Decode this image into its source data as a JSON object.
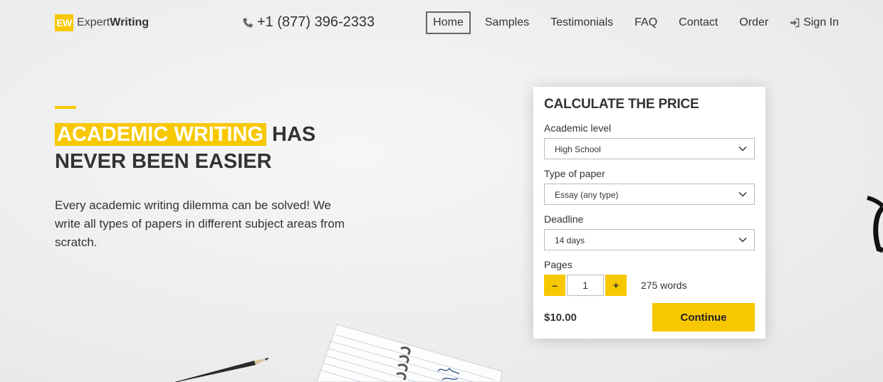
{
  "header": {
    "logo_badge": "EW",
    "logo_text_light": "Expert",
    "logo_text_bold": "Writing",
    "phone": "+1 (877) 396-2333",
    "nav": {
      "home": "Home",
      "samples": "Samples",
      "testimonials": "Testimonials",
      "faq": "FAQ",
      "contact": "Contact",
      "order": "Order",
      "sign_in": "Sign In"
    }
  },
  "hero": {
    "title_highlight": "ACADEMIC WRITING",
    "title_rest": "HAS",
    "title_line2": "NEVER BEEN EASIER",
    "description": "Every academic writing dilemma can be solved! We write all types of papers in different subject areas from scratch."
  },
  "calculator": {
    "title": "CALCULATE THE PRICE",
    "academic_level_label": "Academic level",
    "academic_level_value": "High School",
    "paper_type_label": "Type of paper",
    "paper_type_value": "Essay (any type)",
    "deadline_label": "Deadline",
    "deadline_value": "14 days",
    "pages_label": "Pages",
    "pages_value": "1",
    "minus": "–",
    "plus": "+",
    "words": "275 words",
    "price": "$10.00",
    "continue_label": "Continue"
  },
  "colors": {
    "accent": "#f7c800",
    "text": "#333333"
  },
  "icons": [
    "phone-icon",
    "sign-in-icon",
    "chevron-down-icon"
  ]
}
